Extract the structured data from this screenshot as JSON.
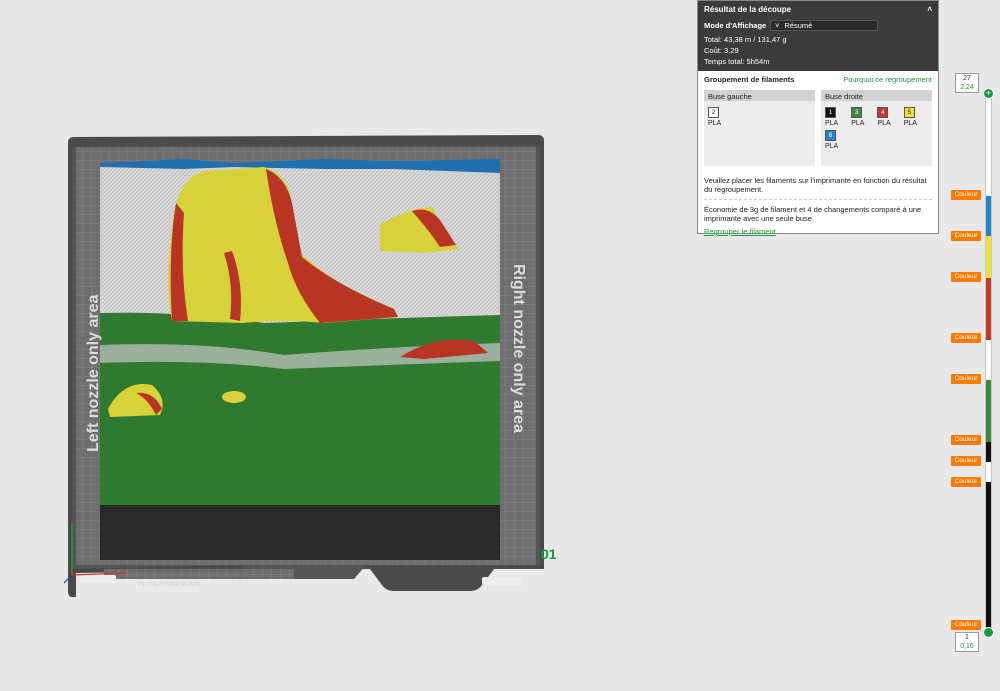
{
  "panel": {
    "title": "Résultat de la découpe",
    "mode_label": "Mode d'Affichage",
    "mode_value": "Résumé",
    "total_label": "Total:",
    "total_value": "43,38 m / 131,47 g",
    "cost_label": "Coût:",
    "cost_value": "3,29",
    "time_label": "Temps total:",
    "time_value": "5h54m",
    "grouping_title": "Groupement de filaments",
    "why_link": "Pourquoi ce regroupement",
    "left_nozzle": {
      "label": "Buse gauche",
      "filaments": [
        {
          "num": "2",
          "type": "PLA",
          "color": "#ffffff",
          "text_color": "#222222"
        }
      ]
    },
    "right_nozzle": {
      "label": "Buse droite",
      "filaments": [
        {
          "num": "1",
          "type": "PLA",
          "color": "#111111",
          "text_color": "#ffffff"
        },
        {
          "num": "3",
          "type": "PLA",
          "color": "#3b8a3b",
          "text_color": "#ffffff"
        },
        {
          "num": "4",
          "type": "PLA",
          "color": "#c0392b",
          "text_color": "#ffffff"
        },
        {
          "num": "5",
          "type": "PLA",
          "color": "#f1e23a",
          "text_color": "#222222"
        },
        {
          "num": "6",
          "type": "PLA",
          "color": "#1f86c8",
          "text_color": "#ffffff"
        }
      ]
    },
    "message1": "Veuillez placer les filaments sur l'imprimante en fonction du résultat du regroupement.",
    "message2": "Économie de 3g de filament et 4 de changements comparé à une imprimante avec une seule buse.",
    "regroup_link": "Regrouper le filament"
  },
  "slider": {
    "top_layer": "27",
    "top_height": "2,24",
    "bottom_layer": "1",
    "bottom_height": "0,16",
    "color_change_label": "Couleur",
    "top_handle_glyph": "+"
  },
  "bed": {
    "left_zone": "Left nozzle only area",
    "right_zone": "Right nozzle only area",
    "plate_number": "01",
    "brand": "PEI TEXTURE PLATE"
  },
  "colors": {
    "accent": "#1a9a3a",
    "couleur_badge": "#ff7a00",
    "bed": "#4a4a4a"
  }
}
